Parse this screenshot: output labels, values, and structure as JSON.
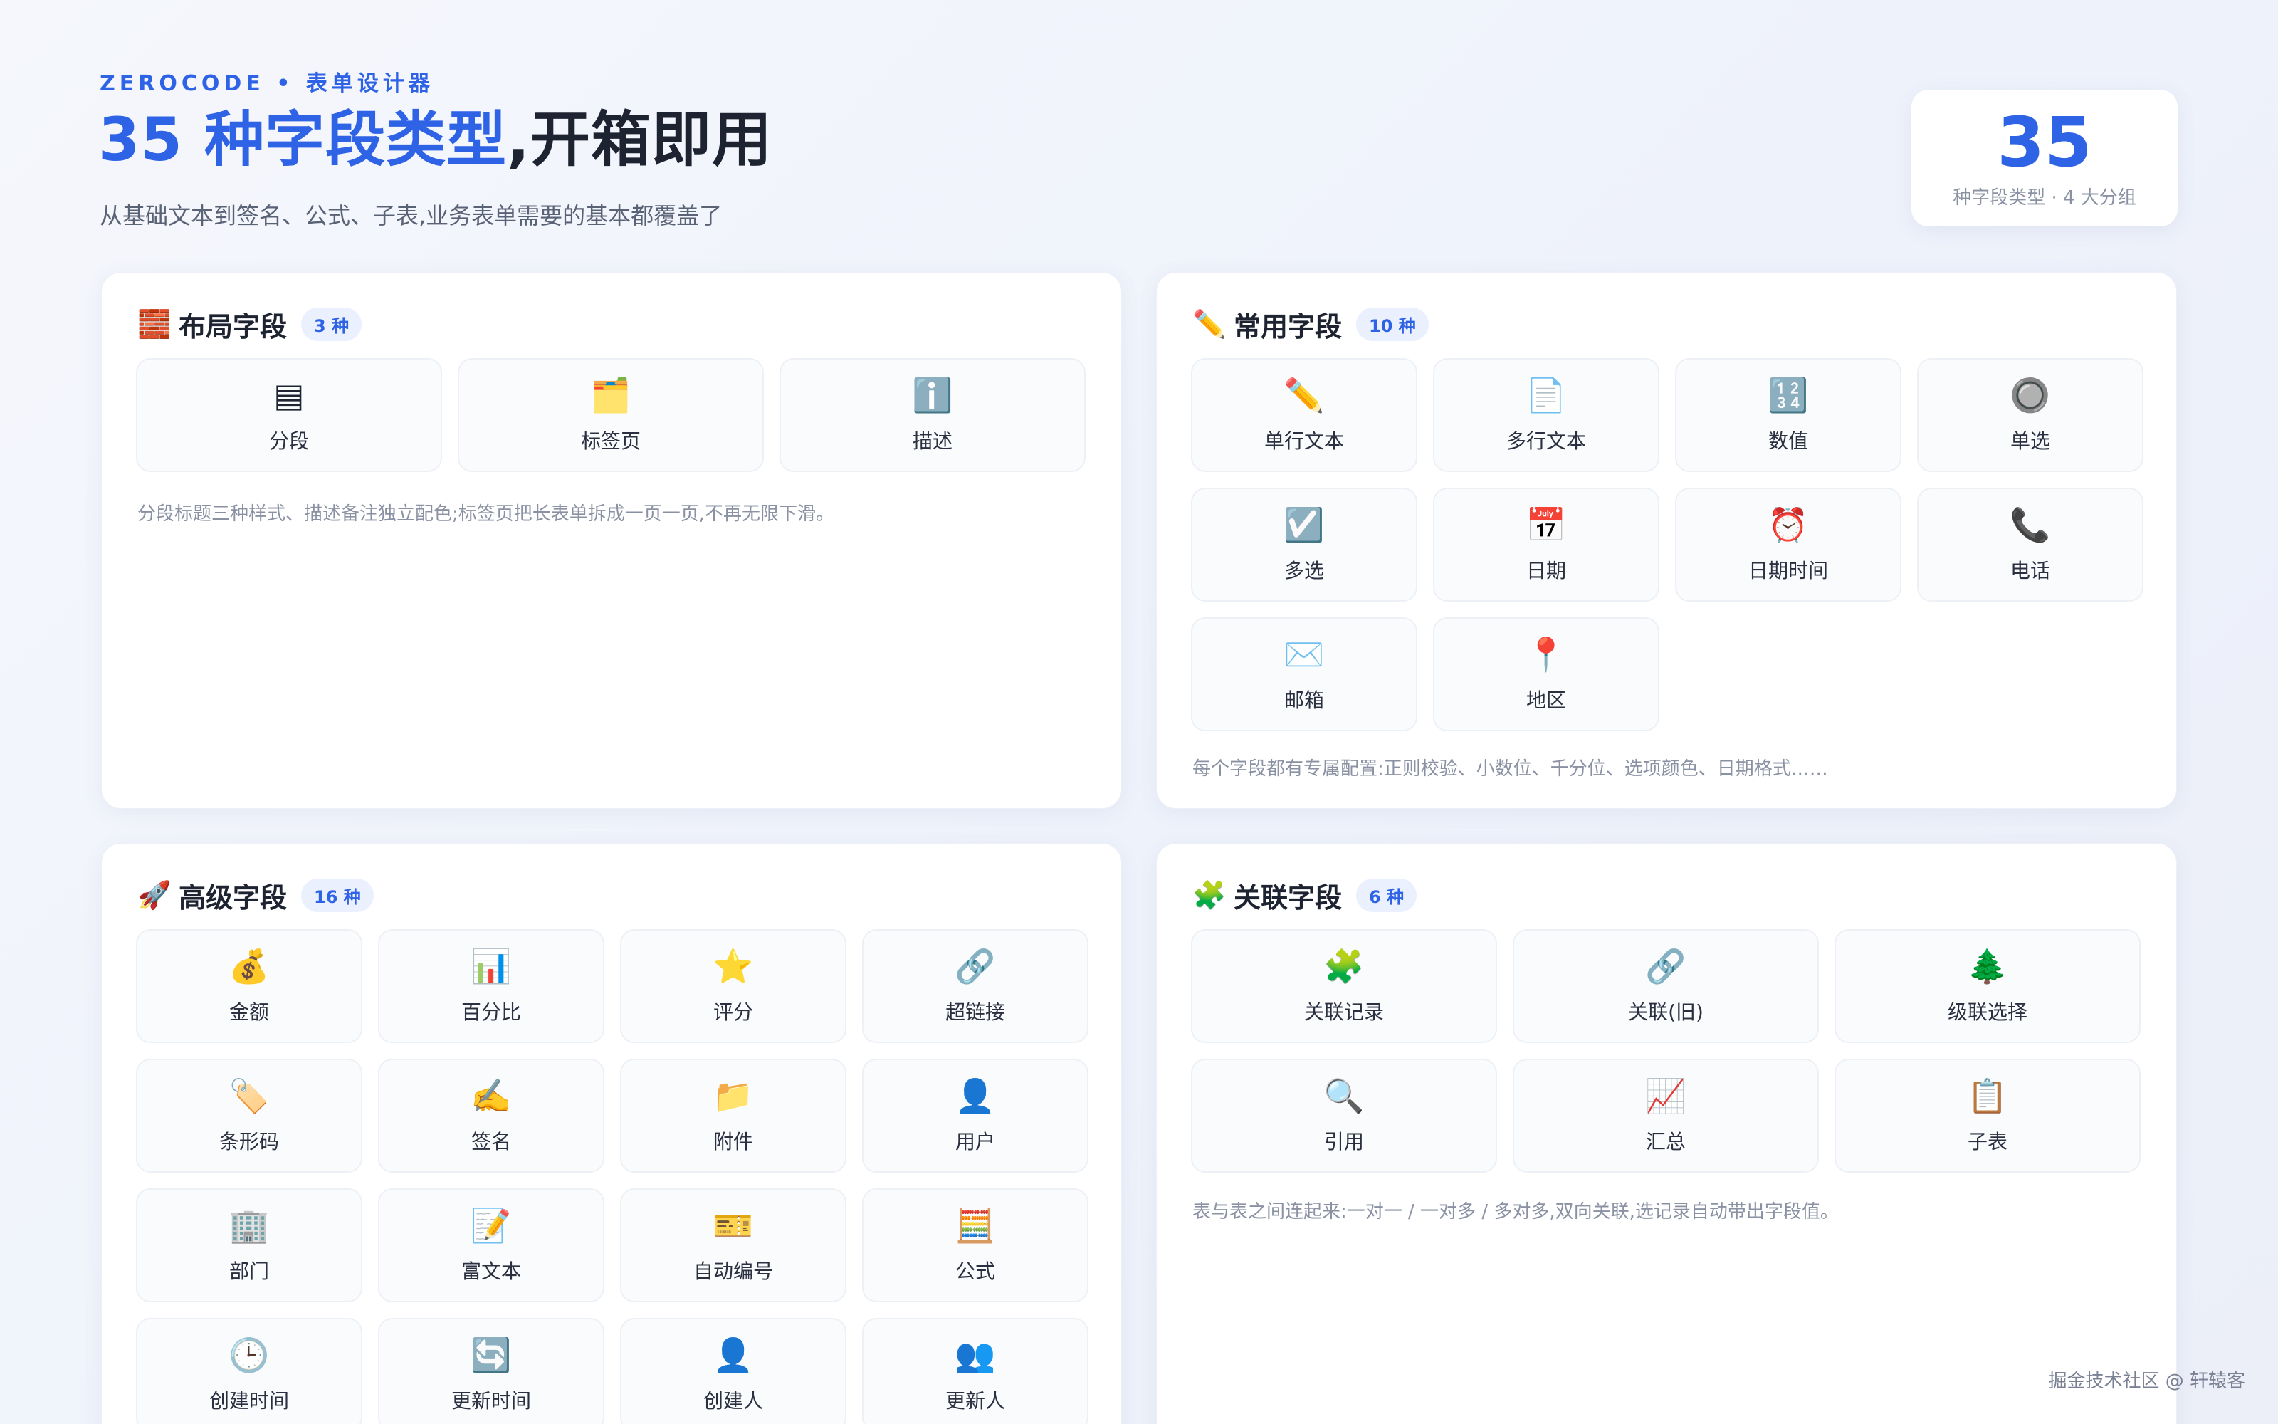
{
  "header": {
    "eyebrow": "ZEROCODE • 表单设计器",
    "title_accent": "35 种字段类型",
    "title_rest": ",开箱即用",
    "subtitle": "从基础文本到签名、公式、子表,业务表单需要的基本都覆盖了"
  },
  "stat": {
    "number": "35",
    "caption": "种字段类型 · 4 大分组"
  },
  "colors": {
    "accent": "#2f63e6",
    "badge_bg": "#eaf0fe",
    "text_dark": "#1d2330",
    "muted": "#8a91a3"
  },
  "panels": {
    "layout": {
      "icon": "🧱",
      "icon_name": "bricks-icon",
      "title": "布局字段",
      "badge": "3 种",
      "note": "分段标题三种样式、描述备注独立配色;标签页把长表单拆成一页一页,不再无限下滑。",
      "fields": [
        {
          "icon": "▤",
          "icon_name": "section-icon",
          "label": "分段"
        },
        {
          "icon": "🗂️",
          "icon_name": "folder-tab-icon",
          "label": "标签页"
        },
        {
          "icon": "ℹ️",
          "icon_name": "info-icon",
          "label": "描述"
        }
      ]
    },
    "common": {
      "icon": "✏️",
      "icon_name": "pencil-icon",
      "title": "常用字段",
      "badge": "10 种",
      "note": "每个字段都有专属配置:正则校验、小数位、千分位、选项颜色、日期格式……",
      "fields": [
        {
          "icon": "✏️",
          "icon_name": "pencil-icon",
          "label": "单行文本"
        },
        {
          "icon": "📄",
          "icon_name": "document-icon",
          "label": "多行文本"
        },
        {
          "icon": "🔢",
          "icon_name": "numbers-icon",
          "label": "数值"
        },
        {
          "icon": "🔘",
          "icon_name": "radio-icon",
          "label": "单选"
        },
        {
          "icon": "☑️",
          "icon_name": "checkbox-icon",
          "label": "多选"
        },
        {
          "icon": "📅",
          "icon_name": "calendar-icon",
          "label": "日期"
        },
        {
          "icon": "⏰",
          "icon_name": "alarm-clock-icon",
          "label": "日期时间"
        },
        {
          "icon": "📞",
          "icon_name": "phone-icon",
          "label": "电话"
        },
        {
          "icon": "✉️",
          "icon_name": "envelope-icon",
          "label": "邮箱"
        },
        {
          "icon": "📍",
          "icon_name": "pin-icon",
          "label": "地区"
        }
      ]
    },
    "advanced": {
      "icon": "🚀",
      "icon_name": "rocket-icon",
      "title": "高级字段",
      "badge": "16 种",
      "fields": [
        {
          "icon": "💰",
          "icon_name": "money-bag-icon",
          "label": "金额"
        },
        {
          "icon": "📊",
          "icon_name": "bar-chart-icon",
          "label": "百分比"
        },
        {
          "icon": "⭐",
          "icon_name": "star-icon",
          "label": "评分"
        },
        {
          "icon": "🔗",
          "icon_name": "link-icon",
          "label": "超链接"
        },
        {
          "icon": "🏷️",
          "icon_name": "tag-icon",
          "label": "条形码"
        },
        {
          "icon": "✍️",
          "icon_name": "signature-icon",
          "label": "签名"
        },
        {
          "icon": "📁",
          "icon_name": "folder-icon",
          "label": "附件"
        },
        {
          "icon": "👤",
          "icon_name": "user-icon",
          "label": "用户"
        },
        {
          "icon": "🏢",
          "icon_name": "building-icon",
          "label": "部门"
        },
        {
          "icon": "📝",
          "icon_name": "memo-icon",
          "label": "富文本"
        },
        {
          "icon": "🎫",
          "icon_name": "ticket-icon",
          "label": "自动编号"
        },
        {
          "icon": "🧮",
          "icon_name": "abacus-icon",
          "label": "公式"
        },
        {
          "icon": "🕒",
          "icon_name": "clock-icon",
          "label": "创建时间"
        },
        {
          "icon": "🔄",
          "icon_name": "refresh-icon",
          "label": "更新时间"
        },
        {
          "icon": "👤",
          "icon_name": "creator-icon",
          "label": "创建人"
        },
        {
          "icon": "👥",
          "icon_name": "users-icon",
          "label": "更新人"
        }
      ]
    },
    "relation": {
      "icon": "🧩",
      "icon_name": "puzzle-icon",
      "title": "关联字段",
      "badge": "6 种",
      "note": "表与表之间连起来:一对一 / 一对多 / 多对多,双向关联,选记录自动带出字段值。",
      "fields": [
        {
          "icon": "🧩",
          "icon_name": "puzzle-icon",
          "label": "关联记录"
        },
        {
          "icon": "🔗",
          "icon_name": "link-icon",
          "label": "关联(旧)"
        },
        {
          "icon": "🌲",
          "icon_name": "tree-icon",
          "label": "级联选择"
        },
        {
          "icon": "🔍",
          "icon_name": "magnifier-icon",
          "label": "引用"
        },
        {
          "icon": "📈",
          "icon_name": "line-chart-icon",
          "label": "汇总"
        },
        {
          "icon": "📋",
          "icon_name": "clipboard-icon",
          "label": "子表"
        }
      ]
    }
  },
  "footer": {
    "credit": "掘金技术社区 @ 轩辕客"
  }
}
